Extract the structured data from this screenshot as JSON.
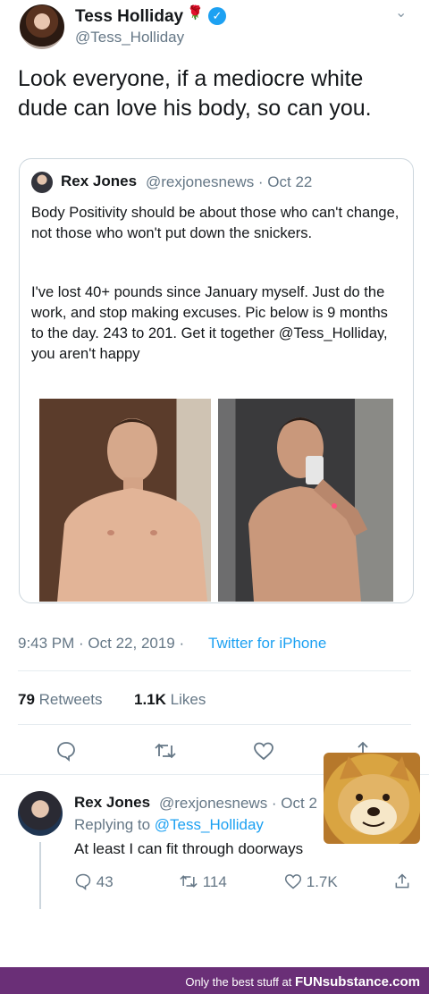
{
  "tweet": {
    "author_name": "Tess Holliday",
    "author_handle": "@Tess_Holliday",
    "text": "Look everyone, if a mediocre white dude can love his body, so can you.",
    "timestamp": "9:43 PM · Oct 22, 2019 ·",
    "source": "Twitter for iPhone",
    "retweets_count": "79",
    "retweets_label": "Retweets",
    "likes_count": "1.1K",
    "likes_label": "Likes"
  },
  "quote": {
    "author_name": "Rex Jones",
    "meta": "@rexjonesnews · Oct 22",
    "para1": "Body Positivity should be about those who can't change, not those who won't put down the snickers.",
    "para2": "I've lost 40+ pounds since January myself. Just do the work, and stop making excuses. Pic below is 9 months to the day. 243 to 201. Get it together @Tess_Holliday, you aren't happy"
  },
  "reply": {
    "author_name": "Rex Jones",
    "meta": "@rexjonesnews · Oct 2",
    "replying_prefix": "Replying to",
    "replying_to": "@Tess_Holliday",
    "text": "At least I can fit through doorways",
    "reply_count": "43",
    "retweet_count": "114",
    "like_count": "1.7K"
  },
  "footer": {
    "prefix": "Only the best stuff at",
    "brand": "FUNsubstance.com"
  }
}
